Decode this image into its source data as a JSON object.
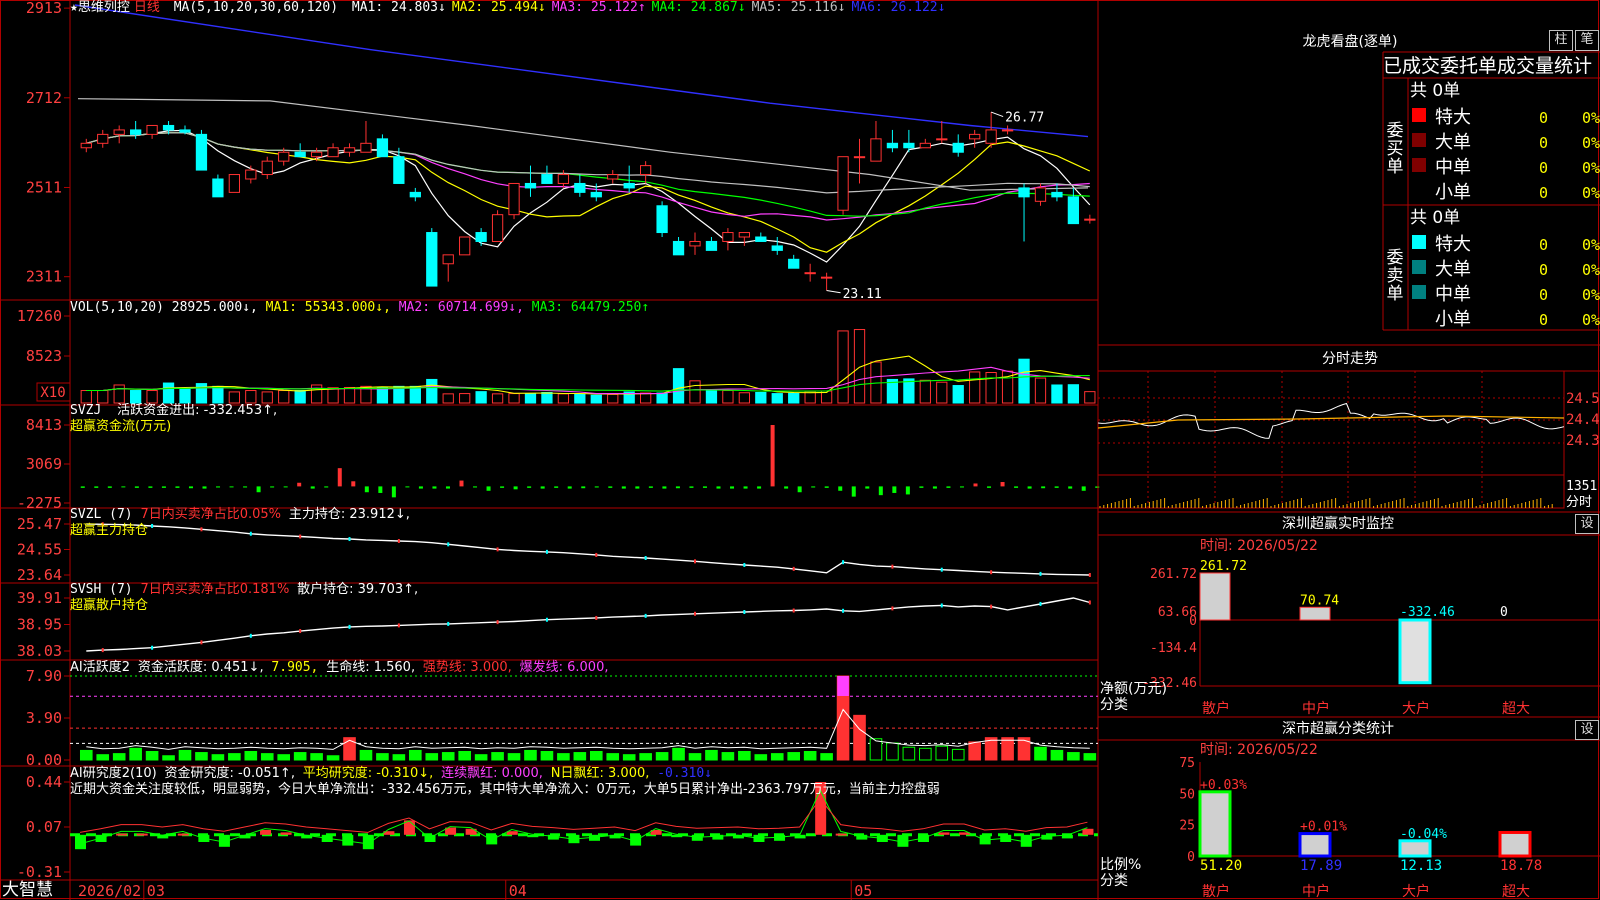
{
  "app": {
    "brand": "大智慧",
    "stock_name": "思维列控",
    "period": "日线"
  },
  "colors": {
    "up": "#ff3232",
    "down": "#00ffff",
    "grid": "#b00000",
    "axis_text": "#ff4040",
    "white": "#ffffff",
    "yellow": "#ffff00",
    "magenta": "#ff40ff",
    "green": "#00ff00",
    "blue": "#3030ff",
    "gray": "#c0c0c0"
  },
  "date_axis": {
    "year_label": "2026/02",
    "months": [
      {
        "label": "03",
        "index": 4
      },
      {
        "label": "04",
        "index": 26
      },
      {
        "label": "05",
        "index": 47
      }
    ]
  },
  "candle_panel": {
    "ma_header": "MA(5,10,20,30,60,120)",
    "ma_items": [
      {
        "label": "MA1: 24.803↓",
        "color": "#ffffff"
      },
      {
        "label": "MA2: 25.494↓",
        "color": "#ffff00"
      },
      {
        "label": "MA3: 25.122↑",
        "color": "#ff40ff"
      },
      {
        "label": "MA4: 24.867↓",
        "color": "#00ff00"
      },
      {
        "label": "MA5: 25.116↓",
        "color": "#c0c0c0"
      },
      {
        "label": "MA6: 26.122↓",
        "color": "#3030ff"
      }
    ],
    "y_ticks": [
      "2913",
      "2712",
      "2511",
      "2311"
    ],
    "y_range": [
      22.7,
      29.2
    ],
    "tick_values": [
      29.13,
      27.12,
      25.11,
      23.11
    ],
    "high_label": "26.77",
    "low_label": "23.11"
  },
  "chart_data": [
    {
      "type": "candlestick",
      "title": "思维列控 日线",
      "ohlc": [
        [
          26.0,
          26.2,
          25.9,
          26.1
        ],
        [
          26.1,
          26.4,
          26.0,
          26.3
        ],
        [
          26.3,
          26.5,
          26.1,
          26.4
        ],
        [
          26.4,
          26.6,
          26.2,
          26.3
        ],
        [
          26.3,
          26.5,
          26.2,
          26.5
        ],
        [
          26.5,
          26.6,
          26.3,
          26.4
        ],
        [
          26.4,
          26.5,
          26.3,
          26.35
        ],
        [
          26.3,
          26.4,
          25.5,
          25.5
        ],
        [
          25.3,
          25.4,
          24.9,
          24.9
        ],
        [
          25.0,
          25.4,
          25.0,
          25.4
        ],
        [
          25.3,
          25.6,
          25.2,
          25.5
        ],
        [
          25.4,
          25.8,
          25.3,
          25.7
        ],
        [
          25.7,
          26.0,
          25.6,
          25.9
        ],
        [
          25.9,
          26.1,
          25.8,
          25.8
        ],
        [
          25.8,
          26.0,
          25.7,
          25.9
        ],
        [
          25.8,
          26.1,
          25.8,
          26.0
        ],
        [
          25.9,
          26.1,
          25.8,
          26.0
        ],
        [
          25.9,
          26.6,
          25.9,
          26.1
        ],
        [
          26.2,
          26.3,
          25.8,
          25.8
        ],
        [
          25.8,
          26.0,
          25.2,
          25.2
        ],
        [
          25.0,
          25.1,
          24.8,
          24.9
        ],
        [
          24.1,
          24.2,
          22.9,
          22.9
        ],
        [
          23.4,
          23.6,
          23.0,
          23.6
        ],
        [
          23.6,
          24.0,
          23.6,
          24.0
        ],
        [
          24.1,
          24.2,
          23.8,
          23.9
        ],
        [
          23.9,
          24.6,
          23.9,
          24.5
        ],
        [
          24.5,
          25.2,
          24.4,
          25.2
        ],
        [
          25.2,
          25.6,
          24.9,
          25.1
        ],
        [
          25.4,
          25.6,
          25.2,
          25.2
        ],
        [
          25.2,
          25.5,
          25.1,
          25.4
        ],
        [
          25.2,
          25.4,
          24.9,
          25.0
        ],
        [
          25.0,
          25.2,
          24.8,
          24.9
        ],
        [
          25.3,
          25.5,
          25.2,
          25.4
        ],
        [
          25.2,
          25.6,
          25.0,
          25.1
        ],
        [
          25.4,
          25.7,
          25.2,
          25.6
        ],
        [
          24.7,
          24.8,
          24.0,
          24.1
        ],
        [
          23.9,
          24.0,
          23.6,
          23.6
        ],
        [
          23.8,
          24.1,
          23.6,
          23.9
        ],
        [
          23.9,
          24.0,
          23.7,
          23.7
        ],
        [
          23.9,
          24.2,
          23.7,
          24.1
        ],
        [
          24.0,
          24.1,
          23.8,
          24.1
        ],
        [
          24.0,
          24.1,
          23.9,
          23.9
        ],
        [
          23.8,
          24.0,
          23.6,
          23.7
        ],
        [
          23.5,
          23.6,
          23.3,
          23.3
        ],
        [
          23.2,
          23.4,
          23.0,
          23.2
        ],
        [
          23.1,
          23.2,
          22.8,
          23.1
        ],
        [
          24.6,
          25.8,
          24.5,
          25.8
        ],
        [
          25.8,
          26.2,
          25.2,
          25.8
        ],
        [
          25.7,
          26.6,
          25.7,
          26.2
        ],
        [
          26.1,
          26.4,
          25.9,
          26.0
        ],
        [
          26.1,
          26.4,
          25.9,
          26.0
        ],
        [
          26.0,
          26.2,
          26.0,
          26.1
        ],
        [
          26.2,
          26.6,
          26.1,
          26.2
        ],
        [
          26.1,
          26.3,
          25.8,
          25.9
        ],
        [
          26.2,
          26.4,
          26.0,
          26.3
        ],
        [
          26.1,
          26.8,
          26.0,
          26.4
        ],
        [
          26.4,
          26.5,
          26.3,
          26.4
        ],
        [
          25.1,
          25.2,
          23.9,
          24.9
        ],
        [
          24.8,
          25.2,
          24.7,
          25.1
        ],
        [
          25.0,
          25.2,
          24.8,
          24.9
        ],
        [
          24.9,
          25.1,
          24.3,
          24.3
        ],
        [
          24.4,
          24.5,
          24.3,
          24.4
        ]
      ]
    },
    {
      "type": "bar",
      "title": "VOL(5,10,20)",
      "values": [
        4500,
        4500,
        6500,
        4500,
        4500,
        7200,
        5200,
        7000,
        6000,
        4000,
        4500,
        4000,
        4500,
        4500,
        6500,
        5500,
        5600,
        6000,
        5600,
        6000,
        6000,
        8500,
        3300,
        3400,
        4100,
        3300,
        3400,
        3400,
        3800,
        3300,
        3200,
        2800,
        3100,
        4000,
        3600,
        3600,
        12400,
        8000,
        4800,
        4500,
        3700,
        3800,
        3400,
        3500,
        4200,
        4300,
        26000,
        26500,
        14800,
        8500,
        8700,
        8200,
        7500,
        6300,
        11200,
        11000,
        11500,
        15800,
        9000,
        6500,
        6600,
        4100
      ],
      "ymax": 17260,
      "y_ticks": [
        "17260",
        "8523",
        "X10"
      ]
    },
    {
      "type": "bar",
      "title": "SVZJ 活跃资金进出",
      "values": [
        -200,
        -200,
        -200,
        -100,
        -200,
        -200,
        -200,
        -200,
        -250,
        -300,
        -150,
        -100,
        -150,
        -800,
        -150,
        -100,
        500,
        -300,
        -150,
        2500,
        700,
        -800,
        -900,
        -1500,
        -100,
        -300,
        -300,
        -300,
        800,
        -150,
        -600,
        -200,
        -400,
        -200,
        -300,
        -200,
        -300,
        -250,
        -150,
        -200,
        -300,
        -300,
        -200,
        -300,
        -250,
        -200,
        -200,
        -300,
        -300,
        -300,
        -300,
        8413,
        -300,
        -800,
        -150,
        -200,
        -600,
        -1400,
        -300,
        -1200,
        -900,
        -1100,
        -200,
        -300,
        -200,
        -150,
        400,
        -200,
        600,
        -200,
        -300,
        -250,
        -200,
        -300,
        -600,
        -200
      ],
      "ylim": [
        -2275,
        8413
      ],
      "y_ticks": [
        "8413",
        "3069",
        "-2275"
      ]
    },
    {
      "type": "line",
      "title": "SVZL 主力持仓",
      "values": [
        25.47,
        25.46,
        25.45,
        25.43,
        25.4,
        25.37,
        25.33,
        25.28,
        25.23,
        25.18,
        25.12,
        25.08,
        25.05,
        25.02,
        24.99,
        24.95,
        24.93,
        24.9,
        24.88,
        24.86,
        24.84,
        24.8,
        24.74,
        24.68,
        24.62,
        24.56,
        24.52,
        24.49,
        24.47,
        24.44,
        24.4,
        24.36,
        24.31,
        24.28,
        24.25,
        24.21,
        24.17,
        24.13,
        24.08,
        24.04,
        24.0,
        23.96,
        23.92,
        23.86,
        23.79,
        23.72,
        24.1,
        24.02,
        23.96,
        23.94,
        23.9,
        23.86,
        23.83,
        23.8,
        23.77,
        23.74,
        23.72,
        23.7,
        23.68,
        23.66,
        23.65,
        23.64
      ],
      "y_ticks": [
        "25.47",
        "24.55",
        "23.64"
      ]
    },
    {
      "type": "line",
      "title": "SVSH 散户持仓",
      "values": [
        38.07,
        38.1,
        38.12,
        38.15,
        38.18,
        38.24,
        38.3,
        38.36,
        38.43,
        38.5,
        38.58,
        38.64,
        38.68,
        38.74,
        38.79,
        38.84,
        38.88,
        38.9,
        38.91,
        38.93,
        38.95,
        38.97,
        38.98,
        39.0,
        39.02,
        39.04,
        39.06,
        39.09,
        39.12,
        39.14,
        39.16,
        39.18,
        39.21,
        39.23,
        39.25,
        39.28,
        39.3,
        39.32,
        39.34,
        39.36,
        39.38,
        39.4,
        39.42,
        39.43,
        39.45,
        39.48,
        39.42,
        39.4,
        39.45,
        39.5,
        39.55,
        39.58,
        39.6,
        39.55,
        39.58,
        39.56,
        39.45,
        39.55,
        39.65,
        39.75,
        39.85,
        39.7
      ],
      "y_ticks": [
        "39.91",
        "38.95",
        "38.03"
      ]
    },
    {
      "type": "bar",
      "title": "AI活跃度2",
      "values": [
        0.9,
        0.5,
        0.6,
        1.1,
        0.8,
        0.4,
        0.9,
        0.7,
        0.5,
        0.6,
        0.8,
        0.6,
        0.5,
        0.7,
        0.6,
        0.4,
        2.1,
        0.9,
        0.6,
        0.5,
        0.9,
        0.6,
        0.7,
        0.8,
        0.5,
        0.7,
        0.6,
        0.9,
        0.8,
        0.6,
        0.7,
        0.8,
        0.6,
        0.5,
        0.6,
        0.7,
        1.1,
        0.6,
        0.9,
        0.7,
        0.8,
        0.5,
        0.6,
        0.7,
        0.8,
        0.6,
        7.9,
        4.2,
        2.0,
        1.6,
        1.2,
        1.1,
        1.3,
        1.0,
        1.7,
        2.1,
        2.1,
        2.1,
        1.2,
        0.9,
        0.7,
        0.6
      ],
      "ylim": [
        0.0,
        7.9
      ],
      "y_ticks": [
        "7.90",
        "3.90",
        "0.00"
      ]
    },
    {
      "type": "bar",
      "title": "AI研究度2(10)",
      "values": [
        -0.12,
        -0.06,
        0.01,
        0.01,
        -0.03,
        0.01,
        -0.06,
        -0.1,
        -0.03,
        0.04,
        0.02,
        -0.03,
        -0.06,
        -0.09,
        -0.12,
        0.03,
        0.12,
        -0.06,
        0.06,
        0.05,
        -0.08,
        0.03,
        -0.02,
        -0.04,
        -0.07,
        -0.05,
        -0.03,
        -0.09,
        0.04,
        -0.02,
        -0.05,
        -0.04,
        -0.03,
        -0.06,
        -0.05,
        -0.03,
        0.44,
        0.01,
        -0.04,
        -0.06,
        -0.1,
        -0.06,
        0.02,
        0.02,
        -0.08,
        -0.06,
        -0.1,
        -0.04,
        -0.03,
        0.05
      ],
      "ylim": [
        -0.31,
        0.44
      ],
      "y_ticks": [
        "0.44",
        "0.07",
        "-0.31"
      ]
    }
  ],
  "indicators": {
    "vol": {
      "title": "VOL(5,10,20)",
      "value": "28925.000↓,",
      "ma1": "MA1: 55343.000↓,",
      "ma2": "MA2: 60714.699↓,",
      "ma3": "MA3: 64479.250↑"
    },
    "svzj": {
      "title": "SVZJ",
      "label": "活跃资金进出: -332.453↑,",
      "subtitle": "超赢资金流(万元)"
    },
    "svzl": {
      "title": "SVZL (7)",
      "ratio": "7日内买卖净占比0.05%",
      "hold": "主力持仓: 23.912↓,",
      "subtitle": "超赢主力持仓"
    },
    "svsh": {
      "title": "SVSH (7)",
      "ratio": "7日内买卖净占比0.181%",
      "hold": "散户持仓: 39.703↑,",
      "subtitle": "超赢散户持仓"
    },
    "ai_act": {
      "title": "AI活跃度2",
      "a": "资金活跃度: 0.451↓,",
      "b": "7.905,",
      "c": "生命线: 1.560,",
      "d": "强势线: 3.000,",
      "e": "爆发线: 6.000,"
    },
    "ai_res": {
      "title": "AI研究度2(10)",
      "a": "资金研究度: -0.051↑,",
      "b": "平均研究度: -0.310↓,",
      "c": "连续飘红: 0.000,",
      "d": "N日飘红: 3.000,",
      "e": "-0.310↓",
      "comment": "近期大资金关注度较低，明显弱势，今日大单净流出：-332.456万元，其中特大单净流入：0万元，大单5日累计净出-2363.797万元，当前主力控盘弱"
    }
  },
  "right_panel": {
    "dragon_title": "龙虎看盘(逐单)",
    "btn_col": "柱",
    "btn_pen": "笔",
    "order_title": "已成交委托单成交量统计",
    "buy": {
      "side_label": "委买单",
      "total": "共 0单",
      "rows": [
        {
          "label": "特大",
          "count": "0",
          "pct": "0%",
          "color": "#ff0000"
        },
        {
          "label": "大单",
          "count": "0",
          "pct": "0%",
          "color": "#800000"
        },
        {
          "label": "中单",
          "count": "0",
          "pct": "0%",
          "color": "#800000"
        },
        {
          "label": "小单",
          "count": "0",
          "pct": "0%",
          "color": ""
        }
      ]
    },
    "sell": {
      "side_label": "委卖单",
      "total": "共 0单",
      "rows": [
        {
          "label": "特大",
          "count": "0",
          "pct": "0%",
          "color": "#00ffff"
        },
        {
          "label": "大单",
          "count": "0",
          "pct": "0%",
          "color": "#008080"
        },
        {
          "label": "中单",
          "count": "0",
          "pct": "0%",
          "color": "#008080"
        },
        {
          "label": "小单",
          "count": "0",
          "pct": "0%",
          "color": ""
        }
      ]
    },
    "intraday": {
      "title": "分时走势",
      "y_ticks": [
        "24.54",
        "24.42",
        "24.30"
      ],
      "vol_tick": "1351",
      "bottom_label": "分时"
    },
    "monitor": {
      "title": "深圳超赢实时监控",
      "set_label": "设",
      "time": "时间: 2026/05/22",
      "y_ticks": [
        "261.72",
        "63.66",
        "0",
        "-134.4",
        "-332.46"
      ],
      "ylabel": "净额(万元)",
      "xlabel": "分类",
      "categories": [
        "散户",
        "中户",
        "大户",
        "超大"
      ],
      "values": [
        261.72,
        70.74,
        -332.46,
        0
      ],
      "value_labels": [
        "261.72",
        "70.74",
        "-332.46",
        "0"
      ]
    },
    "classify": {
      "title": "深市超赢分类统计",
      "set_label": "设",
      "time": "时间: 2026/05/22",
      "y_ticks": [
        "75",
        "50",
        "25",
        "0"
      ],
      "ylabel": "比例%",
      "xlabel": "分类",
      "categories": [
        "散户",
        "中户",
        "大户",
        "超大"
      ],
      "values": [
        51.2,
        17.89,
        12.13,
        18.78
      ],
      "changes": [
        "+0.03%",
        "+0.01%",
        "-0.04%",
        ""
      ]
    }
  }
}
